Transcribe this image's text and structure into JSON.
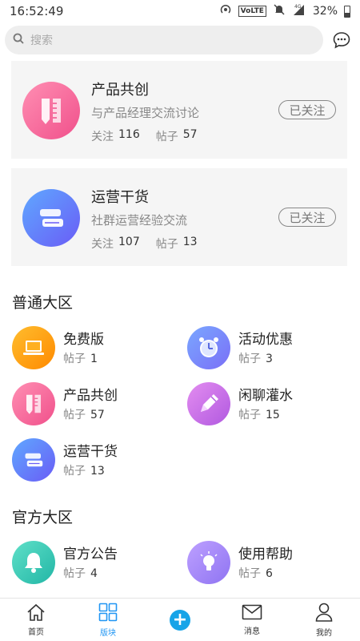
{
  "status_bar": {
    "time": "16:52:49",
    "volte": "VoLTE",
    "network": "4G",
    "battery": "32%"
  },
  "search": {
    "placeholder": "搜索"
  },
  "followed_boards": [
    {
      "title": "产品共创",
      "desc": "与产品经理交流讨论",
      "follow_label": "关注",
      "follows": "116",
      "posts_label": "帖子",
      "posts": "57",
      "button": "已关注",
      "icon": "ruler-pencil-icon"
    },
    {
      "title": "运营干货",
      "desc": "社群运营经验交流",
      "follow_label": "关注",
      "follows": "107",
      "posts_label": "帖子",
      "posts": "13",
      "button": "已关注",
      "icon": "books-icon"
    }
  ],
  "general_section": {
    "title": "普通大区",
    "items": [
      {
        "name": "免费版",
        "posts_label": "帖子",
        "posts": "1",
        "icon": "laptop-icon"
      },
      {
        "name": "活动优惠",
        "posts_label": "帖子",
        "posts": "3",
        "icon": "alarm-clock-icon"
      },
      {
        "name": "产品共创",
        "posts_label": "帖子",
        "posts": "57",
        "icon": "ruler-pencil-icon"
      },
      {
        "name": "闲聊灌水",
        "posts_label": "帖子",
        "posts": "15",
        "icon": "pencil-icon"
      },
      {
        "name": "运营干货",
        "posts_label": "帖子",
        "posts": "13",
        "icon": "books-icon"
      }
    ]
  },
  "official_section": {
    "title": "官方大区",
    "items": [
      {
        "name": "官方公告",
        "posts_label": "帖子",
        "posts": "4",
        "icon": "bell-icon"
      },
      {
        "name": "使用帮助",
        "posts_label": "帖子",
        "posts": "6",
        "icon": "lightbulb-icon"
      }
    ]
  },
  "tabbar": {
    "items": [
      {
        "label": "首页",
        "icon": "home-icon"
      },
      {
        "label": "版块",
        "icon": "grid-icon",
        "active": true
      },
      {
        "label": "",
        "icon": "plus-icon"
      },
      {
        "label": "消息",
        "icon": "mail-icon"
      },
      {
        "label": "我的",
        "icon": "user-icon"
      }
    ]
  },
  "colors": {
    "accent": "#2196f3",
    "plus": "#17a4e8"
  }
}
